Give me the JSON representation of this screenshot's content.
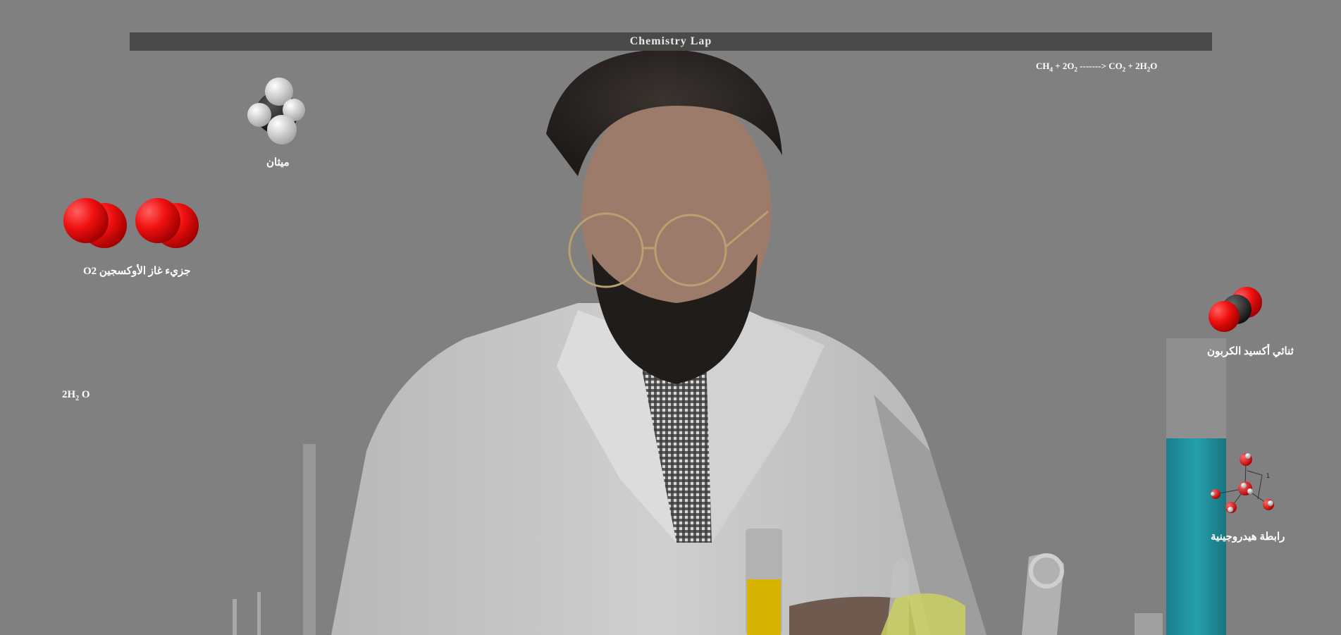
{
  "header": {
    "title": "Chemistry Lap"
  },
  "equation": {
    "ch": "CH",
    "ch_sub": "4",
    "plus1": " + 2O",
    "o_sub": "2",
    "arrow": " -------> CO",
    "co_sub": "2",
    "plus2": " + 2H",
    "h_sub": "2",
    "end": "O"
  },
  "molecules": {
    "methane": {
      "label": "ميثان",
      "icon": "methane-molecule-icon"
    },
    "oxygen": {
      "label": "جزيء غاز الأوكسجين O2",
      "icon": "oxygen-molecule-icon"
    },
    "water": {
      "label_main": "2H",
      "label_sub": "2",
      "label_end": "O"
    },
    "carbon_dioxide": {
      "label": "ثنائي أكسيد الكربون",
      "icon": "co2-molecule-icon"
    },
    "hydrogen_bond": {
      "label": "رابطة هيدروجينية",
      "icon": "hydrogen-bond-icon",
      "annotation": "1"
    }
  },
  "colors": {
    "page_bg": "#808080",
    "title_bar": "#4a4a4a",
    "oxygen": "#ff1010",
    "carbon": "#2a2a2a",
    "hydrogen": "#f2f2f2",
    "cylinder_liquid": "#1e8a98",
    "tube_liquid": "#d6b400"
  }
}
